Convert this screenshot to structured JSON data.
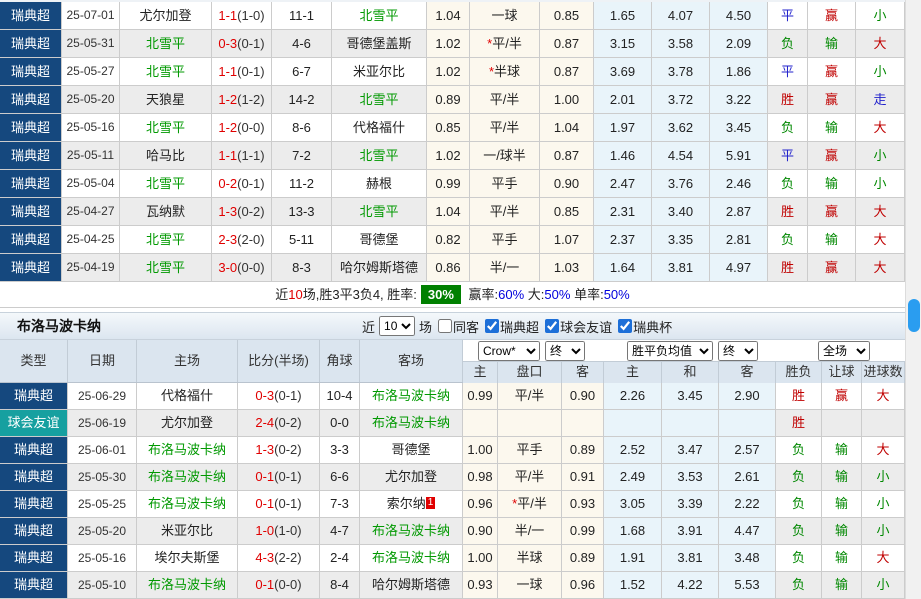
{
  "colors": {
    "league_navy": "#15487e",
    "league_teal": "#16a0a0",
    "odds_cream": "#fcf8ee",
    "avg_lightblue": "#e9f4fa",
    "win_red": "#c00000",
    "lose_green": "#008800",
    "draw_blue": "#2222cc",
    "team_green": "#009900",
    "score_red": "#e00000",
    "badge_green": "#008000",
    "pct_blue": "#0000dd",
    "scrollbar_blue": "#2a9df0"
  },
  "table1": {
    "rows": [
      {
        "league": "瑞典超",
        "league_class": "navy",
        "date": "25-07-01",
        "home": "尤尔加登",
        "home_green": false,
        "score": "1-1",
        "half": "(1-0)",
        "corner": "11-1",
        "away": "北雪平",
        "away_green": true,
        "away_badge": "",
        "w_home": "1.04",
        "handicap": "一球",
        "handicap_star": false,
        "w_away": "0.85",
        "avg_home": "1.65",
        "avg_draw": "4.07",
        "avg_away": "4.50",
        "res_wdl": "平",
        "res_let": "赢",
        "res_goal": "小"
      },
      {
        "league": "瑞典超",
        "league_class": "navy",
        "date": "25-05-31",
        "home": "北雪平",
        "home_green": true,
        "score": "0-3",
        "half": "(0-1)",
        "corner": "4-6",
        "away": "哥德堡盖斯",
        "away_green": false,
        "away_badge": "",
        "w_home": "1.02",
        "handicap": "平/半",
        "handicap_star": true,
        "w_away": "0.87",
        "avg_home": "3.15",
        "avg_draw": "3.58",
        "avg_away": "2.09",
        "res_wdl": "负",
        "res_let": "输",
        "res_goal": "大"
      },
      {
        "league": "瑞典超",
        "league_class": "navy",
        "date": "25-05-27",
        "home": "北雪平",
        "home_green": true,
        "score": "1-1",
        "half": "(0-1)",
        "corner": "6-7",
        "away": "米亚尔比",
        "away_green": false,
        "away_badge": "",
        "w_home": "1.02",
        "handicap": "半球",
        "handicap_star": true,
        "w_away": "0.87",
        "avg_home": "3.69",
        "avg_draw": "3.78",
        "avg_away": "1.86",
        "res_wdl": "平",
        "res_let": "赢",
        "res_goal": "小"
      },
      {
        "league": "瑞典超",
        "league_class": "navy",
        "date": "25-05-20",
        "home": "天狼星",
        "home_green": false,
        "score": "1-2",
        "half": "(1-2)",
        "corner": "14-2",
        "away": "北雪平",
        "away_green": true,
        "away_badge": "",
        "w_home": "0.89",
        "handicap": "平/半",
        "handicap_star": false,
        "w_away": "1.00",
        "avg_home": "2.01",
        "avg_draw": "3.72",
        "avg_away": "3.22",
        "res_wdl": "胜",
        "res_let": "赢",
        "res_goal": "走"
      },
      {
        "league": "瑞典超",
        "league_class": "navy",
        "date": "25-05-16",
        "home": "北雪平",
        "home_green": true,
        "score": "1-2",
        "half": "(0-0)",
        "corner": "8-6",
        "away": "代格福什",
        "away_green": false,
        "away_badge": "",
        "w_home": "0.85",
        "handicap": "平/半",
        "handicap_star": false,
        "w_away": "1.04",
        "avg_home": "1.97",
        "avg_draw": "3.62",
        "avg_away": "3.45",
        "res_wdl": "负",
        "res_let": "输",
        "res_goal": "大"
      },
      {
        "league": "瑞典超",
        "league_class": "navy",
        "date": "25-05-11",
        "home": "哈马比",
        "home_green": false,
        "score": "1-1",
        "half": "(1-1)",
        "corner": "7-2",
        "away": "北雪平",
        "away_green": true,
        "away_badge": "",
        "w_home": "1.02",
        "handicap": "一/球半",
        "handicap_star": false,
        "w_away": "0.87",
        "avg_home": "1.46",
        "avg_draw": "4.54",
        "avg_away": "5.91",
        "res_wdl": "平",
        "res_let": "赢",
        "res_goal": "小"
      },
      {
        "league": "瑞典超",
        "league_class": "navy",
        "date": "25-05-04",
        "home": "北雪平",
        "home_green": true,
        "score": "0-2",
        "half": "(0-1)",
        "corner": "11-2",
        "away": "赫根",
        "away_green": false,
        "away_badge": "",
        "w_home": "0.99",
        "handicap": "平手",
        "handicap_star": false,
        "w_away": "0.90",
        "avg_home": "2.47",
        "avg_draw": "3.76",
        "avg_away": "2.46",
        "res_wdl": "负",
        "res_let": "输",
        "res_goal": "小"
      },
      {
        "league": "瑞典超",
        "league_class": "navy",
        "date": "25-04-27",
        "home": "瓦纳默",
        "home_green": false,
        "score": "1-3",
        "half": "(0-2)",
        "corner": "13-3",
        "away": "北雪平",
        "away_green": true,
        "away_badge": "",
        "w_home": "1.04",
        "handicap": "平/半",
        "handicap_star": false,
        "w_away": "0.85",
        "avg_home": "2.31",
        "avg_draw": "3.40",
        "avg_away": "2.87",
        "res_wdl": "胜",
        "res_let": "赢",
        "res_goal": "大"
      },
      {
        "league": "瑞典超",
        "league_class": "navy",
        "date": "25-04-25",
        "home": "北雪平",
        "home_green": true,
        "score": "2-3",
        "half": "(2-0)",
        "corner": "5-11",
        "away": "哥德堡",
        "away_green": false,
        "away_badge": "",
        "w_home": "0.82",
        "handicap": "平手",
        "handicap_star": false,
        "w_away": "1.07",
        "avg_home": "2.37",
        "avg_draw": "3.35",
        "avg_away": "2.81",
        "res_wdl": "负",
        "res_let": "输",
        "res_goal": "大"
      },
      {
        "league": "瑞典超",
        "league_class": "navy",
        "date": "25-04-19",
        "home": "北雪平",
        "home_green": true,
        "score": "3-0",
        "half": "(0-0)",
        "corner": "8-3",
        "away": "哈尔姆斯塔德",
        "away_green": false,
        "away_badge": "",
        "w_home": "0.86",
        "handicap": "半/一",
        "handicap_star": false,
        "w_away": "1.03",
        "avg_home": "1.64",
        "avg_draw": "3.81",
        "avg_away": "4.97",
        "res_wdl": "胜",
        "res_let": "赢",
        "res_goal": "大"
      }
    ]
  },
  "summary": {
    "segments": [
      {
        "text": "近",
        "style": "plain"
      },
      {
        "text": "10",
        "style": "red"
      },
      {
        "text": "场,胜3平3负4, 胜率:",
        "style": "plain"
      },
      {
        "text": "30%",
        "style": "badge"
      },
      {
        "text": " 赢率:",
        "style": "plain"
      },
      {
        "text": "60%",
        "style": "blue"
      },
      {
        "text": " 大:",
        "style": "plain"
      },
      {
        "text": "50%",
        "style": "blue"
      },
      {
        "text": " 单率:",
        "style": "plain"
      },
      {
        "text": "50%",
        "style": "blue"
      }
    ]
  },
  "section2": {
    "title": "布洛马波卡纳",
    "filter": {
      "recent_label": "近",
      "count_value": "10",
      "games_label": "场",
      "checkboxes": [
        {
          "label": "同客",
          "checked": false
        },
        {
          "label": "瑞典超",
          "checked": true
        },
        {
          "label": "球会友谊",
          "checked": true
        },
        {
          "label": "瑞典杯",
          "checked": true
        }
      ]
    }
  },
  "table_header": {
    "left_cols": [
      "类型",
      "日期",
      "主场",
      "比分(半场)",
      "角球",
      "客场"
    ],
    "selects": [
      "Crow*",
      "终",
      "胜平负均值",
      "终",
      "全场"
    ],
    "sub_cols": [
      "主",
      "盘口",
      "客",
      "主",
      "和",
      "客",
      "胜负",
      "让球",
      "进球数"
    ]
  },
  "table2": {
    "rows": [
      {
        "league": "瑞典超",
        "league_class": "navy",
        "date": "25-06-29",
        "home": "代格福什",
        "home_green": false,
        "score": "0-3",
        "half": "(0-1)",
        "corner": "10-4",
        "away": "布洛马波卡纳",
        "away_green": true,
        "away_badge": "",
        "w_home": "0.99",
        "handicap": "平/半",
        "handicap_star": false,
        "w_away": "0.90",
        "avg_home": "2.26",
        "avg_draw": "3.45",
        "avg_away": "2.90",
        "res_wdl": "胜",
        "res_let": "赢",
        "res_goal": "大"
      },
      {
        "league": "球会友谊",
        "league_class": "teal",
        "date": "25-06-19",
        "home": "尤尔加登",
        "home_green": false,
        "score": "2-4",
        "half": "(0-2)",
        "corner": "0-0",
        "away": "布洛马波卡纳",
        "away_green": true,
        "away_badge": "",
        "w_home": "",
        "handicap": "",
        "handicap_star": false,
        "w_away": "",
        "avg_home": "",
        "avg_draw": "",
        "avg_away": "",
        "res_wdl": "胜",
        "res_let": "",
        "res_goal": ""
      },
      {
        "league": "瑞典超",
        "league_class": "navy",
        "date": "25-06-01",
        "home": "布洛马波卡纳",
        "home_green": true,
        "score": "1-3",
        "half": "(0-2)",
        "corner": "3-3",
        "away": "哥德堡",
        "away_green": false,
        "away_badge": "",
        "w_home": "1.00",
        "handicap": "平手",
        "handicap_star": false,
        "w_away": "0.89",
        "avg_home": "2.52",
        "avg_draw": "3.47",
        "avg_away": "2.57",
        "res_wdl": "负",
        "res_let": "输",
        "res_goal": "大"
      },
      {
        "league": "瑞典超",
        "league_class": "navy",
        "date": "25-05-30",
        "home": "布洛马波卡纳",
        "home_green": true,
        "score": "0-1",
        "half": "(0-1)",
        "corner": "6-6",
        "away": "尤尔加登",
        "away_green": false,
        "away_badge": "",
        "w_home": "0.98",
        "handicap": "平/半",
        "handicap_star": false,
        "w_away": "0.91",
        "avg_home": "2.49",
        "avg_draw": "3.53",
        "avg_away": "2.61",
        "res_wdl": "负",
        "res_let": "输",
        "res_goal": "小"
      },
      {
        "league": "瑞典超",
        "league_class": "navy",
        "date": "25-05-25",
        "home": "布洛马波卡纳",
        "home_green": true,
        "score": "0-1",
        "half": "(0-1)",
        "corner": "7-3",
        "away": "索尔纳",
        "away_green": false,
        "away_badge": "1",
        "w_home": "0.96",
        "handicap": "平/半",
        "handicap_star": true,
        "w_away": "0.93",
        "avg_home": "3.05",
        "avg_draw": "3.39",
        "avg_away": "2.22",
        "res_wdl": "负",
        "res_let": "输",
        "res_goal": "小"
      },
      {
        "league": "瑞典超",
        "league_class": "navy",
        "date": "25-05-20",
        "home": "米亚尔比",
        "home_green": false,
        "score": "1-0",
        "half": "(1-0)",
        "corner": "4-7",
        "away": "布洛马波卡纳",
        "away_green": true,
        "away_badge": "",
        "w_home": "0.90",
        "handicap": "半/一",
        "handicap_star": false,
        "w_away": "0.99",
        "avg_home": "1.68",
        "avg_draw": "3.91",
        "avg_away": "4.47",
        "res_wdl": "负",
        "res_let": "输",
        "res_goal": "小"
      },
      {
        "league": "瑞典超",
        "league_class": "navy",
        "date": "25-05-16",
        "home": "埃尔夫斯堡",
        "home_green": false,
        "score": "4-3",
        "half": "(2-2)",
        "corner": "2-4",
        "away": "布洛马波卡纳",
        "away_green": true,
        "away_badge": "",
        "w_home": "1.00",
        "handicap": "半球",
        "handicap_star": false,
        "w_away": "0.89",
        "avg_home": "1.91",
        "avg_draw": "3.81",
        "avg_away": "3.48",
        "res_wdl": "负",
        "res_let": "输",
        "res_goal": "大"
      },
      {
        "league": "瑞典超",
        "league_class": "navy",
        "date": "25-05-10",
        "home": "布洛马波卡纳",
        "home_green": true,
        "score": "0-1",
        "half": "(0-0)",
        "corner": "8-4",
        "away": "哈尔姆斯塔德",
        "away_green": false,
        "away_badge": "",
        "w_home": "0.93",
        "handicap": "一球",
        "handicap_star": false,
        "w_away": "0.96",
        "avg_home": "1.52",
        "avg_draw": "4.22",
        "avg_away": "5.53",
        "res_wdl": "负",
        "res_let": "输",
        "res_goal": "小"
      }
    ]
  }
}
